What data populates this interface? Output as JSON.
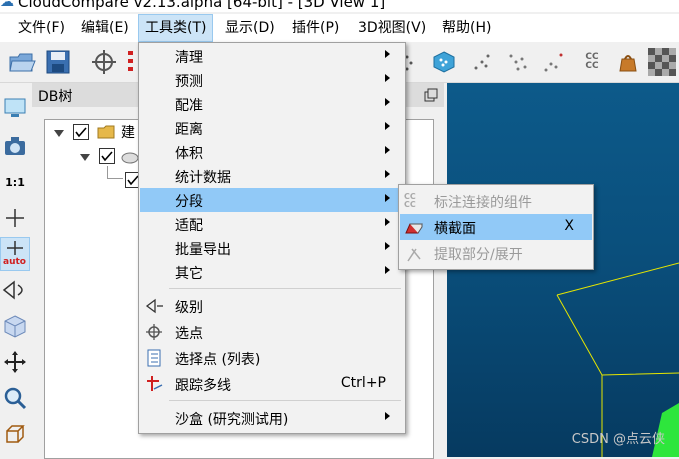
{
  "window": {
    "title": "CloudCompare v2.13.alpha [64-bit] - [3D View 1]"
  },
  "menubar": [
    {
      "label": "文件(F)"
    },
    {
      "label": "编辑(E)"
    },
    {
      "label": "工具类(T)"
    },
    {
      "label": "显示(D)"
    },
    {
      "label": "插件(P)"
    },
    {
      "label": "3D视图(V)"
    },
    {
      "label": "帮助(H)"
    }
  ],
  "db_panel": {
    "title": "DB树",
    "tree": {
      "root_label": "建"
    }
  },
  "left_toolbar": {
    "scale_label": "1:1",
    "auto_label": "auto"
  },
  "toolbar": {
    "cc_label": "CC\nCC"
  },
  "tools_menu": {
    "items": [
      {
        "label": "清理"
      },
      {
        "label": "预测"
      },
      {
        "label": "配准"
      },
      {
        "label": "距离"
      },
      {
        "label": "体积"
      },
      {
        "label": "统计数据"
      },
      {
        "label": "分段"
      },
      {
        "label": "适配"
      },
      {
        "label": "批量导出"
      },
      {
        "label": "其它"
      },
      {
        "label": "级别"
      },
      {
        "label": "选点"
      },
      {
        "label": "选择点 (列表)"
      },
      {
        "label": "跟踪多线",
        "shortcut": "Ctrl+P"
      },
      {
        "label": "沙盒 (研究测试用)"
      }
    ]
  },
  "segment_submenu": {
    "items": [
      {
        "label": "标注连接的组件",
        "icon_text": "CC\nCC"
      },
      {
        "label": "横截面",
        "shortcut": "X"
      },
      {
        "label": "提取部分/展开"
      }
    ]
  },
  "watermark": "CSDN @点云侠",
  "colors": {
    "highlight": "#91c9f7",
    "view_bg": "#0a4f7c",
    "bbox": "#e6e600",
    "point_cloud": "#2ee63c"
  }
}
